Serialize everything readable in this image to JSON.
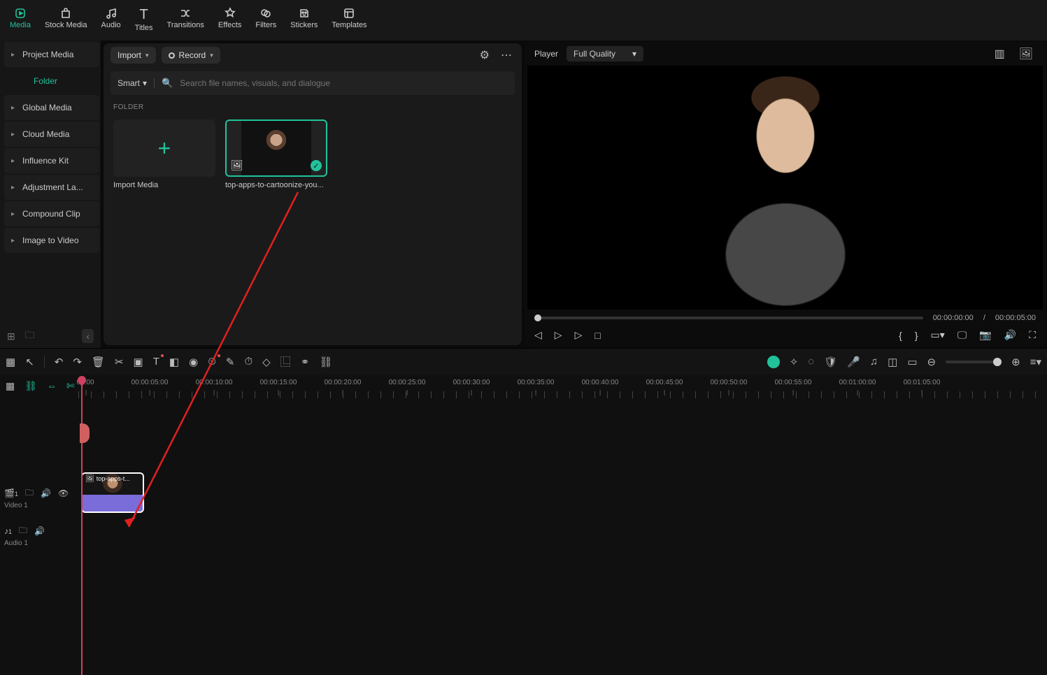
{
  "tabs": {
    "media": "Media",
    "stock": "Stock Media",
    "audio": "Audio",
    "titles": "Titles",
    "transitions": "Transitions",
    "effects": "Effects",
    "filters": "Filters",
    "stickers": "Stickers",
    "templates": "Templates"
  },
  "sidebar": {
    "project_media": "Project Media",
    "folder": "Folder",
    "global_media": "Global Media",
    "cloud_media": "Cloud Media",
    "influence_kit": "Influence Kit",
    "adjustment": "Adjustment La...",
    "compound": "Compound Clip",
    "image_to_video": "Image to Video"
  },
  "mediabar": {
    "import": "Import",
    "record": "Record",
    "smart": "Smart",
    "search_placeholder": "Search file names, visuals, and dialogue",
    "folder_section": "FOLDER",
    "import_tile": "Import Media",
    "asset_name": "top-apps-to-cartoonize-you..."
  },
  "player": {
    "label": "Player",
    "quality": "Full Quality",
    "current": "00:00:00:00",
    "sep": "/",
    "total": "00:00:05:00"
  },
  "ruler": [
    "00:00",
    "00:00:05:00",
    "00:00:10:00",
    "00:00:15:00",
    "00:00:20:00",
    "00:00:25:00",
    "00:00:30:00",
    "00:00:35:00",
    "00:00:40:00",
    "00:00:45:00",
    "00:00:50:00",
    "00:00:55:00",
    "00:01:00:00",
    "00:01:05:00"
  ],
  "tracks": {
    "video_badge": "1",
    "video_label": "Video 1",
    "audio_badge": "1",
    "audio_label": "Audio 1",
    "clip_label": "top-apps-t..."
  }
}
